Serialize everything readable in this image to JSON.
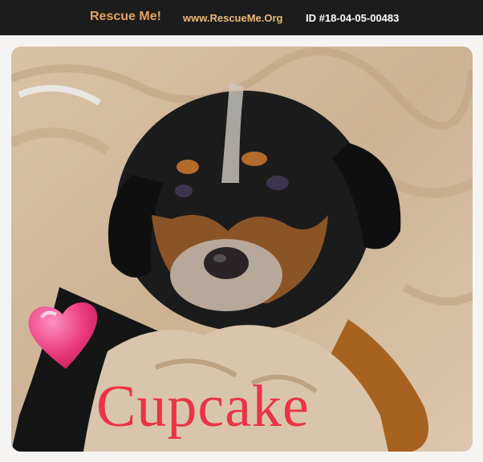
{
  "header": {
    "brand": "Rescue Me!",
    "site": "www.RescueMe.Org",
    "listing_id": "ID #18-04-05-00483"
  },
  "photo": {
    "caption": "Cupcake",
    "decoration_icon": "heart-icon",
    "colors": {
      "header_bg": "#1c1c1c",
      "brand": "#e8a25a",
      "caption": "#ea3346",
      "heart": "#e93a7c"
    }
  }
}
